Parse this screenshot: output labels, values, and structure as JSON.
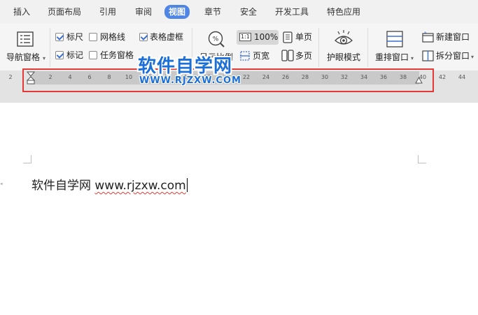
{
  "menu": {
    "items": [
      "插入",
      "页面布局",
      "引用",
      "审阅",
      "视图",
      "章节",
      "安全",
      "开发工具",
      "特色应用"
    ],
    "active_index": 4
  },
  "ribbon": {
    "nav_pane_label": "导航窗格",
    "ruler_label": "标尺",
    "ruler_checked": true,
    "grid_label": "网格线",
    "grid_checked": false,
    "table_gridlines_label": "表格虚框",
    "table_gridlines_checked": true,
    "marks_label": "标记",
    "marks_checked": true,
    "task_pane_label": "任务窗格",
    "task_pane_checked": false,
    "zoom_label": "显示比例",
    "zoom_100_label": "100%",
    "one_page_label": "单页",
    "page_width_label": "页宽",
    "multi_page_label": "多页",
    "eye_mode_label": "护眼模式",
    "arrange_label": "重排窗口",
    "new_window_label": "新建窗口",
    "split_window_label": "拆分窗口"
  },
  "ruler": {
    "left_number": "2",
    "numbers": [
      "2",
      "4",
      "6",
      "8",
      "10",
      "12",
      "14",
      "16",
      "18",
      "20",
      "22",
      "24",
      "26",
      "28",
      "30",
      "32",
      "34",
      "36",
      "38",
      "40",
      "42",
      "44"
    ]
  },
  "watermark": {
    "title": "软件自学网",
    "url": "WWW.RJZXW.COM"
  },
  "document": {
    "text_prefix": "软件自学网 ",
    "text_link": "www.rjzxw.com"
  },
  "colors": {
    "accent": "#4f86e6",
    "highlight_box": "#e53935",
    "watermark": "#1b6fd6"
  }
}
